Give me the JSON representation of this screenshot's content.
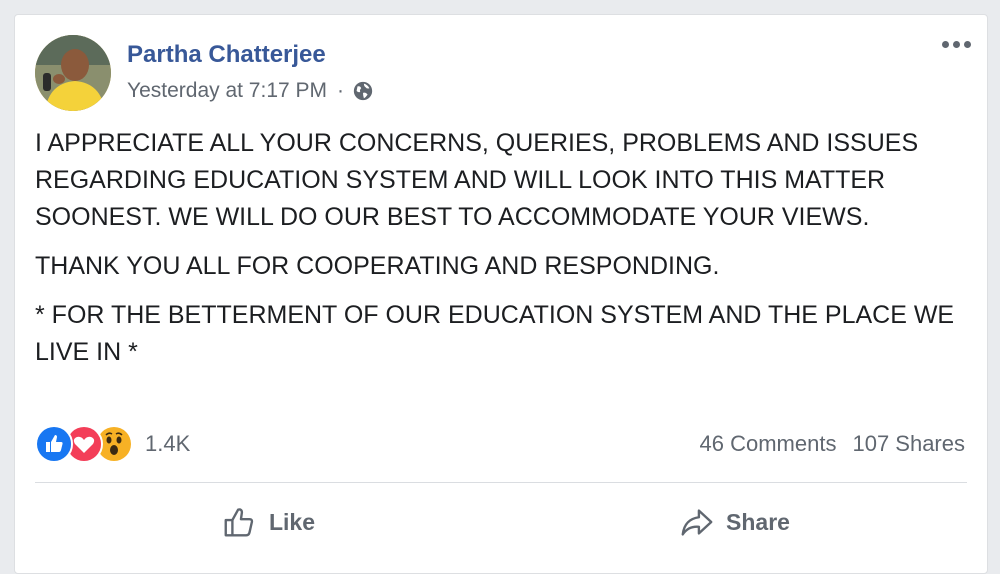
{
  "post": {
    "author": "Partha Chatterjee",
    "timestamp": "Yesterday at 7:17 PM",
    "separator": "·",
    "privacy_icon": "globe-icon",
    "paragraphs": [
      "I APPRECIATE ALL YOUR CONCERNS, QUERIES, PROBLEMS AND ISSUES REGARDING EDUCATION SYSTEM AND WILL LOOK INTO THIS MATTER SOONEST. WE WILL DO OUR BEST TO ACCOMMODATE YOUR VIEWS.",
      "THANK YOU ALL FOR COOPERATING AND RESPONDING.",
      "* FOR THE BETTERMENT OF OUR EDUCATION SYSTEM AND THE PLACE WE LIVE IN *"
    ]
  },
  "engagement": {
    "reactions": [
      "like-reaction-icon",
      "love-reaction-icon",
      "wow-reaction-icon"
    ],
    "reaction_count": "1.4K",
    "comments": "46 Comments",
    "shares": "107 Shares"
  },
  "actions": {
    "like_label": "Like",
    "share_label": "Share"
  },
  "colors": {
    "author": "#385898",
    "like_blue": "#1877f2",
    "love_red": "#f33e58",
    "wow_yellow": "#f7b125"
  }
}
